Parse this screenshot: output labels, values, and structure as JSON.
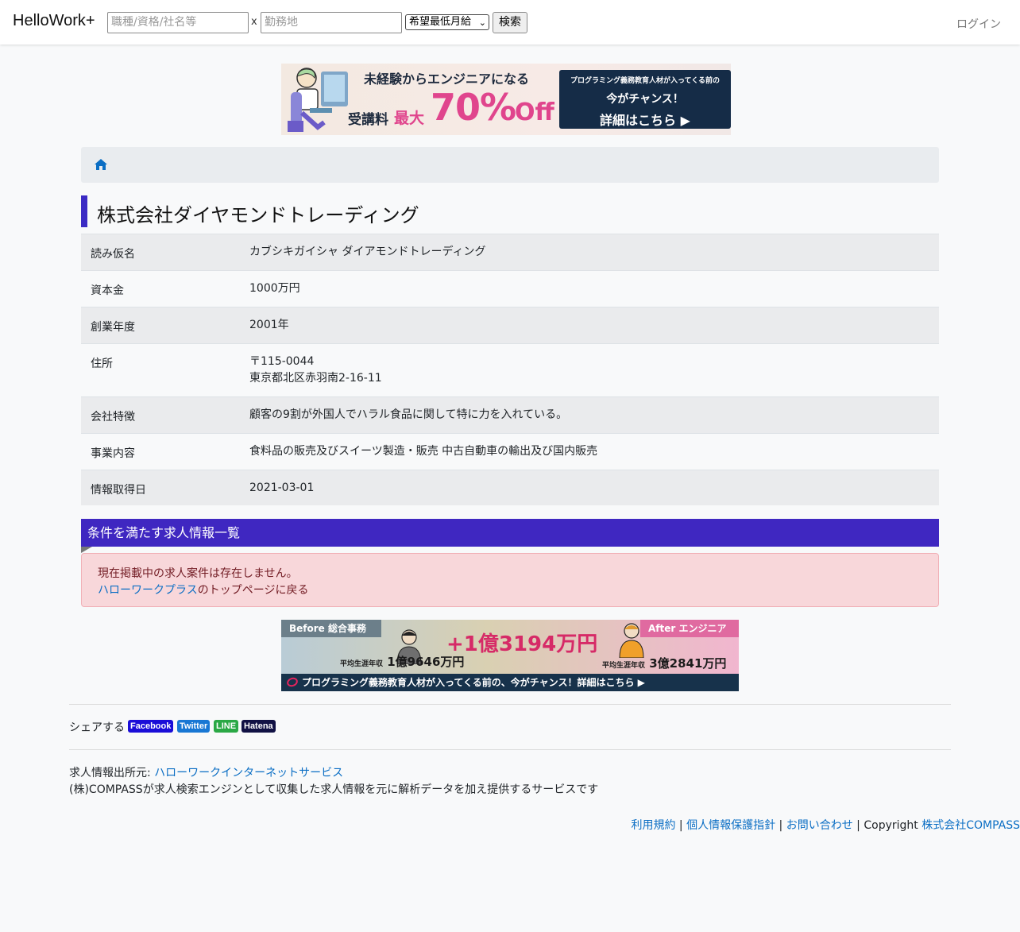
{
  "nav": {
    "brand": "HelloWork+",
    "keyword_placeholder": "職種/資格/社名等",
    "separator": "x",
    "location_placeholder": "勤務地",
    "salary_select": "希望最低月給",
    "search_button": "検索",
    "login": "ログイン"
  },
  "banner_top": {
    "headline": "未経験からエンジニアになる",
    "fee_label": "受講料",
    "max_label": "最大",
    "discount": "70%",
    "off": "Off",
    "panel_line1": "プログラミング義務教育人材が入ってくる前の",
    "panel_line2": "今がチャンス！",
    "panel_line3": "詳細はこちら ▶"
  },
  "company": {
    "name": "株式会社ダイヤモンドトレーディング",
    "rows": [
      {
        "label": "読み仮名",
        "value": "カブシキガイシャ ダイアモンドトレーディング"
      },
      {
        "label": "資本金",
        "value": "1000万円"
      },
      {
        "label": "創業年度",
        "value": "2001年"
      },
      {
        "label": "住所",
        "value": "〒115-0044",
        "value2": "東京都北区赤羽南2-16-11"
      },
      {
        "label": "会社特徴",
        "value": "顧客の9割が外国人でハラル食品に関して特に力を入れている。"
      },
      {
        "label": "事業内容",
        "value": "食料品の販売及びスイーツ製造・販売 中古自動車の輸出及び国内販売"
      },
      {
        "label": "情報取得日",
        "value": "2021-03-01"
      }
    ]
  },
  "jobs": {
    "header": "条件を満たす求人情報一覧",
    "empty_message": "現在掲載中の求人案件は存在しません。",
    "back_link": "ハローワークプラス",
    "back_suffix": "のトップページに戻る"
  },
  "banner_bottom": {
    "before": "Before 総合事務",
    "after": "After エンジニア",
    "difference": "+1億3194万円",
    "left_label": "平均生涯年収",
    "left_value": "1億9646万円",
    "right_label": "平均生涯年収",
    "right_value": "3億2841万円",
    "strip": "プログラミング義務教育人材が入ってくる前の、今がチャンス！詳細はこちら ▶"
  },
  "share": {
    "label": "シェアする",
    "facebook": "Facebook",
    "twitter": "Twitter",
    "line": "LINE",
    "hatena": "Hatena",
    "colors": {
      "facebook": "#1a0dd8",
      "twitter": "#1877d4",
      "line": "#2aa845",
      "hatena": "#111144"
    }
  },
  "footer": {
    "source_label": "求人情報出所元: ",
    "source_link": "ハローワークインターネットサービス",
    "description": "(株)COMPASSが求人検索エンジンとして収集した求人情報を元に解析データを加え提供するサービスです",
    "terms": "利用規約",
    "privacy": "個人情報保護指針",
    "contact": "お問い合わせ",
    "sep": " | ",
    "copyright": "Copyright ",
    "company": "株式会社COMPASS"
  },
  "colors": {
    "accent": "#3f27c1",
    "link": "#0b6ec4",
    "alert_bg": "#f8d7da",
    "alert_text": "#721c24"
  }
}
